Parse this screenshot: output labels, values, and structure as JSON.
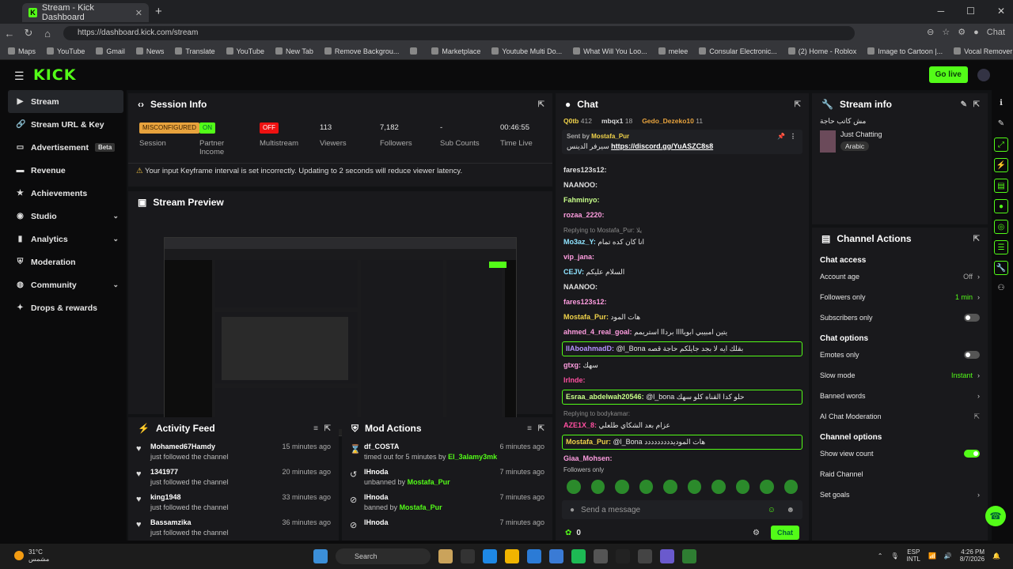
{
  "browser": {
    "tab_title": "Stream - Kick Dashboard",
    "url": "https://dashboard.kick.com/stream",
    "copilot": "Chat",
    "bookmarks": [
      "Maps",
      "YouTube",
      "Gmail",
      "News",
      "Translate",
      "YouTube",
      "New Tab",
      "Remove Backgrou...",
      "",
      "Marketplace",
      "Youtube Multi Do...",
      "What Will You Loo...",
      "melee",
      "Consular Electronic...",
      "(2) Home - Roblox",
      "Image to Cartoon |...",
      "Vocal Remover an..."
    ]
  },
  "header": {
    "logo": "KICK",
    "go_live": "Go live"
  },
  "sidebar": {
    "items": [
      {
        "label": "Stream",
        "icon": "stream-icon"
      },
      {
        "label": "Stream URL & Key",
        "icon": "link-icon"
      },
      {
        "label": "Advertisement",
        "icon": "ad-icon",
        "badge": "Beta"
      },
      {
        "label": "Revenue",
        "icon": "revenue-icon"
      },
      {
        "label": "Achievements",
        "icon": "achievement-icon"
      },
      {
        "label": "Studio",
        "icon": "studio-icon"
      },
      {
        "label": "Analytics",
        "icon": "analytics-icon"
      },
      {
        "label": "Moderation",
        "icon": "moderation-icon"
      },
      {
        "label": "Community",
        "icon": "community-icon"
      },
      {
        "label": "Drops & rewards",
        "icon": "drops-icon"
      }
    ]
  },
  "session": {
    "title": "Session Info",
    "warning": "Your input Keyframe interval is set incorrectly. Updating to 2 seconds will reduce viewer latency.",
    "stats": [
      {
        "value": "MISCONFIGURED",
        "label": "Session"
      },
      {
        "value": "ON",
        "label": "Partner Income"
      },
      {
        "value": "OFF",
        "label": "Multistream"
      },
      {
        "value": "113",
        "label": "Viewers"
      },
      {
        "value": "7,182",
        "label": "Followers"
      },
      {
        "value": "-",
        "label": "Sub Counts"
      },
      {
        "value": "00:46:55",
        "label": "Time Live"
      }
    ]
  },
  "preview": {
    "title": "Stream Preview"
  },
  "activity": {
    "title": "Activity Feed",
    "rows": [
      {
        "name": "Mohamed67Hamdy",
        "sub": "just followed the channel",
        "time": "15 minutes ago"
      },
      {
        "name": "1341977",
        "sub": "just followed the channel",
        "time": "20 minutes ago"
      },
      {
        "name": "king1948",
        "sub": "just followed the channel",
        "time": "33 minutes ago"
      },
      {
        "name": "Bassamzika",
        "sub": "just followed the channel",
        "time": "36 minutes ago"
      }
    ]
  },
  "mod": {
    "title": "Mod Actions",
    "rows": [
      {
        "name": "df_COSTA",
        "pre": "timed out for 5 minutes by",
        "by": "El_3alamy3mk",
        "time": "6 minutes ago"
      },
      {
        "name": "lHnoda",
        "pre": "unbanned by",
        "by": "Mostafa_Pur",
        "time": "7 minutes ago"
      },
      {
        "name": "lHnoda",
        "pre": "banned by",
        "by": "Mostafa_Pur",
        "time": "7 minutes ago"
      },
      {
        "name": "lHnoda",
        "pre": "",
        "by": "",
        "time": "7 minutes ago"
      }
    ]
  },
  "chat": {
    "title": "Chat",
    "top": [
      {
        "name": "Q0tb",
        "n": "412"
      },
      {
        "name": "mbqx1",
        "n": "18"
      },
      {
        "name": "Gedo_Dezeko10",
        "n": "11"
      }
    ],
    "pinned": {
      "by": "Sent by",
      "user": "Mostafa_Pur",
      "text": "سيرفر الدينس",
      "link": "https://discord.gg/YuASZC8s8"
    },
    "messages": [
      {
        "u": "fares123s12:",
        "c": "#e0e0e0",
        "t": ""
      },
      {
        "u": "NAANOO:",
        "c": "#e0e0e0",
        "t": ""
      },
      {
        "u": "Fahminyo:",
        "c": "#c8ff8a",
        "t": ""
      },
      {
        "u": "rozaa_2220:",
        "c": "#ff9de0",
        "t": ""
      },
      {
        "u": "Mo3az_Y:",
        "c": "#8fe3ff",
        "t": "انا كان كده تمام",
        "rep": "Replying to Mostafa_Pur: يلا"
      },
      {
        "u": "vip_jana:",
        "c": "#ff9de0",
        "t": ""
      },
      {
        "u": "CEJV:",
        "c": "#8fe3ff",
        "t": "السلام عليكم"
      },
      {
        "u": "NAANOO:",
        "c": "#e0e0e0",
        "t": ""
      },
      {
        "u": "fares123s12:",
        "c": "#ff9de0",
        "t": ""
      },
      {
        "u": "Mostafa_Pur:",
        "c": "#f0d24a",
        "t": "هات المود"
      },
      {
        "u": "ahmed_4_real_goal:",
        "c": "#ff9de0",
        "t": "يتين امبيبي ابوياااا برداا استريمم"
      },
      {
        "u": "IlAboahmadD:",
        "c": "#b794ff",
        "t": "@l_Bona بقلك ايه لا بجد جايلكم حاجة قصه",
        "hl": true
      },
      {
        "u": "gtxg:",
        "c": "#ff9de0",
        "t": "سهك"
      },
      {
        "u": "lrlnde:",
        "c": "#ff4fa0",
        "t": ""
      },
      {
        "u": "Esraa_abdelwah20546:",
        "c": "#c8ff8a",
        "t": "@l_bona حلو كدا القناه كلو سهك",
        "hl": true
      },
      {
        "u": "AZE1X_8:",
        "c": "#ff4fa0",
        "t": "عزام بعد الشكاي طلعلي",
        "rep": "Replying to bodykamar:"
      },
      {
        "u": "Mostafa_Pur:",
        "c": "#f0d24a",
        "t": "@l_Bona هات الموديددددددددد",
        "hl": true
      },
      {
        "u": "Giaa_Mohsen:",
        "c": "#ff9de0",
        "t": ""
      }
    ],
    "followers_only": "Followers only",
    "placeholder": "Send a message",
    "count": "0",
    "send": "Chat"
  },
  "stream_info": {
    "title": "Stream info",
    "stream_title": "مش كاتب حاجة",
    "category": "Just Chatting",
    "tag": "Arabic"
  },
  "channel": {
    "title": "Channel Actions",
    "access_title": "Chat access",
    "access": [
      {
        "label": "Account age",
        "value": "Off"
      },
      {
        "label": "Followers only",
        "value": "1 min"
      },
      {
        "label": "Subscribers only",
        "value": ""
      }
    ],
    "options_title": "Chat options",
    "options": [
      {
        "label": "Emotes only"
      },
      {
        "label": "Slow mode",
        "value": "Instant"
      },
      {
        "label": "Banned words"
      },
      {
        "label": "AI Chat Moderation"
      }
    ],
    "ch_title": "Channel options",
    "ch": [
      {
        "label": "Show view count"
      },
      {
        "label": "Raid Channel"
      },
      {
        "label": "Set goals"
      }
    ]
  },
  "taskbar": {
    "temp": "31°C",
    "cond": "مشمس",
    "search": "Search",
    "lang": "ESP",
    "lang2": "INTL",
    "time": "4:26 PM",
    "date": "8/7/2026"
  }
}
